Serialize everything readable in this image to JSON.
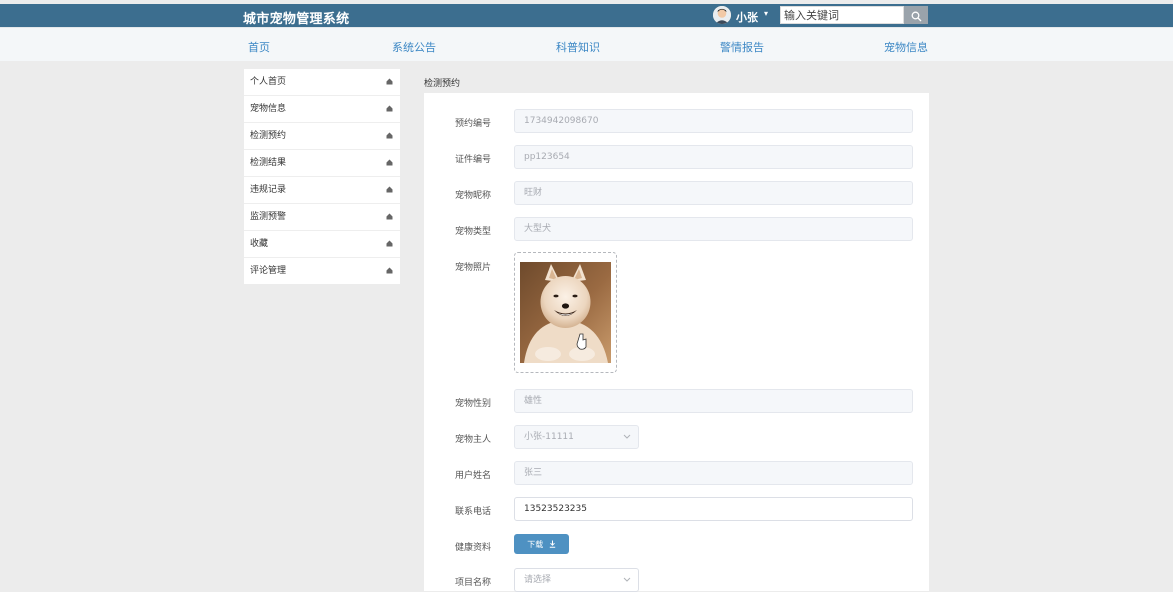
{
  "header": {
    "brand": "城市宠物管理系统",
    "username": "小张",
    "caret": "▾",
    "search_placeholder": "输入关键词"
  },
  "nav": [
    "首页",
    "系统公告",
    "科普知识",
    "警情报告",
    "宠物信息"
  ],
  "sidebar": {
    "items": [
      {
        "label": "个人首页"
      },
      {
        "label": "宠物信息"
      },
      {
        "label": "检测预约"
      },
      {
        "label": "检测结果"
      },
      {
        "label": "违规记录"
      },
      {
        "label": "监测预警"
      },
      {
        "label": "收藏"
      },
      {
        "label": "评论管理"
      }
    ]
  },
  "main": {
    "section_title": "检测预约",
    "fields": {
      "booking_no": {
        "label": "预约编号",
        "value": "1734942098670"
      },
      "cert_no": {
        "label": "证件编号",
        "value": "pp123654"
      },
      "pet_name": {
        "label": "宠物昵称",
        "value": "旺财"
      },
      "pet_type": {
        "label": "宠物类型",
        "value": "大型犬"
      },
      "pet_photo": {
        "label": "宠物照片"
      },
      "pet_gender": {
        "label": "宠物性别",
        "value": "雄性"
      },
      "pet_owner": {
        "label": "宠物主人",
        "value": "小张-11111"
      },
      "user_name": {
        "label": "用户姓名",
        "value": "张三"
      },
      "phone": {
        "label": "联系电话",
        "value": "13523523235"
      },
      "health": {
        "label": "健康资料",
        "button": "下载"
      },
      "project": {
        "label": "项目名称",
        "placeholder": "请选择"
      }
    }
  }
}
